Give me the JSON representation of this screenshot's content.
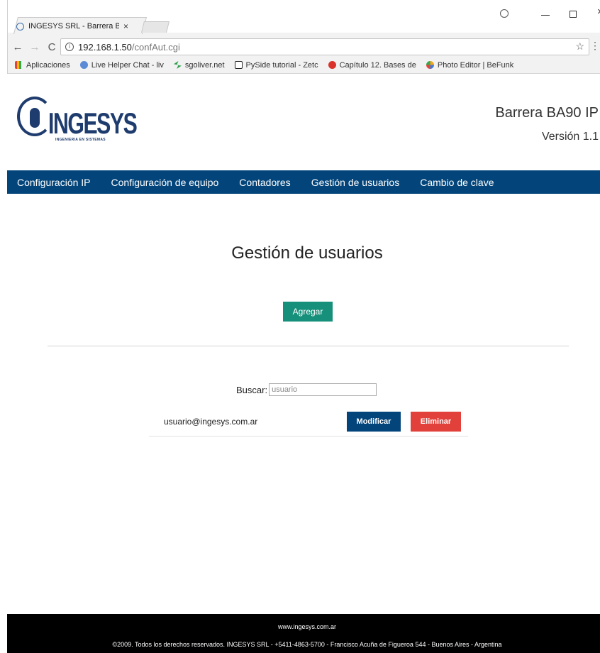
{
  "browser": {
    "tab_title": "INGESYS SRL - Barrera B",
    "tab_close": "×",
    "url_host": "192.168.1.50",
    "url_path": "/confAut.cgi",
    "nav_back": "←",
    "nav_forward": "→",
    "nav_reload": "C",
    "star": "☆",
    "menu": "⋮",
    "close": "×",
    "bookmarks": [
      {
        "label": "Aplicaciones",
        "icon": "apps-icon"
      },
      {
        "label": "Live Helper Chat - liv",
        "icon": "live-helper-icon"
      },
      {
        "label": "sgoliver.net",
        "icon": "sgoliver-icon"
      },
      {
        "label": "PySide tutorial - Zetc",
        "icon": "pyside-icon"
      },
      {
        "label": "Capítulo 12. Bases de",
        "icon": "capitulo-icon"
      },
      {
        "label": "Photo Editor | BeFunk",
        "icon": "photo-editor-icon"
      }
    ]
  },
  "header": {
    "logo_text": "INGESYS",
    "logo_subtitle": "INGENIERIA EN SISTEMAS",
    "product": "Barrera BA90 IP",
    "version": "Versión 1.1"
  },
  "nav": [
    {
      "label": "Configuración IP"
    },
    {
      "label": "Configuración de equipo"
    },
    {
      "label": "Contadores"
    },
    {
      "label": "Gestión de usuarios"
    },
    {
      "label": "Cambio de clave"
    }
  ],
  "main": {
    "title": "Gestión de usuarios",
    "add_label": "Agregar",
    "search_label": "Buscar:",
    "search_placeholder": "usuario",
    "users": [
      {
        "email": "usuario@ingesys.com.ar",
        "modify_label": "Modificar",
        "delete_label": "Eliminar"
      }
    ]
  },
  "footer": {
    "site": "www.ingesys.com.ar",
    "copyright": "©2009. Todos los derechos reservados. INGESYS SRL - +5411-4863-5700 - Francisco Acuña de Figueroa 544 - Buenos Aires - Argentina"
  },
  "colors": {
    "nav_bg": "#03457b",
    "add_button": "#16907a",
    "modify_button": "#03457b",
    "delete_button": "#e2403a",
    "logo": "#1f3c6e"
  }
}
